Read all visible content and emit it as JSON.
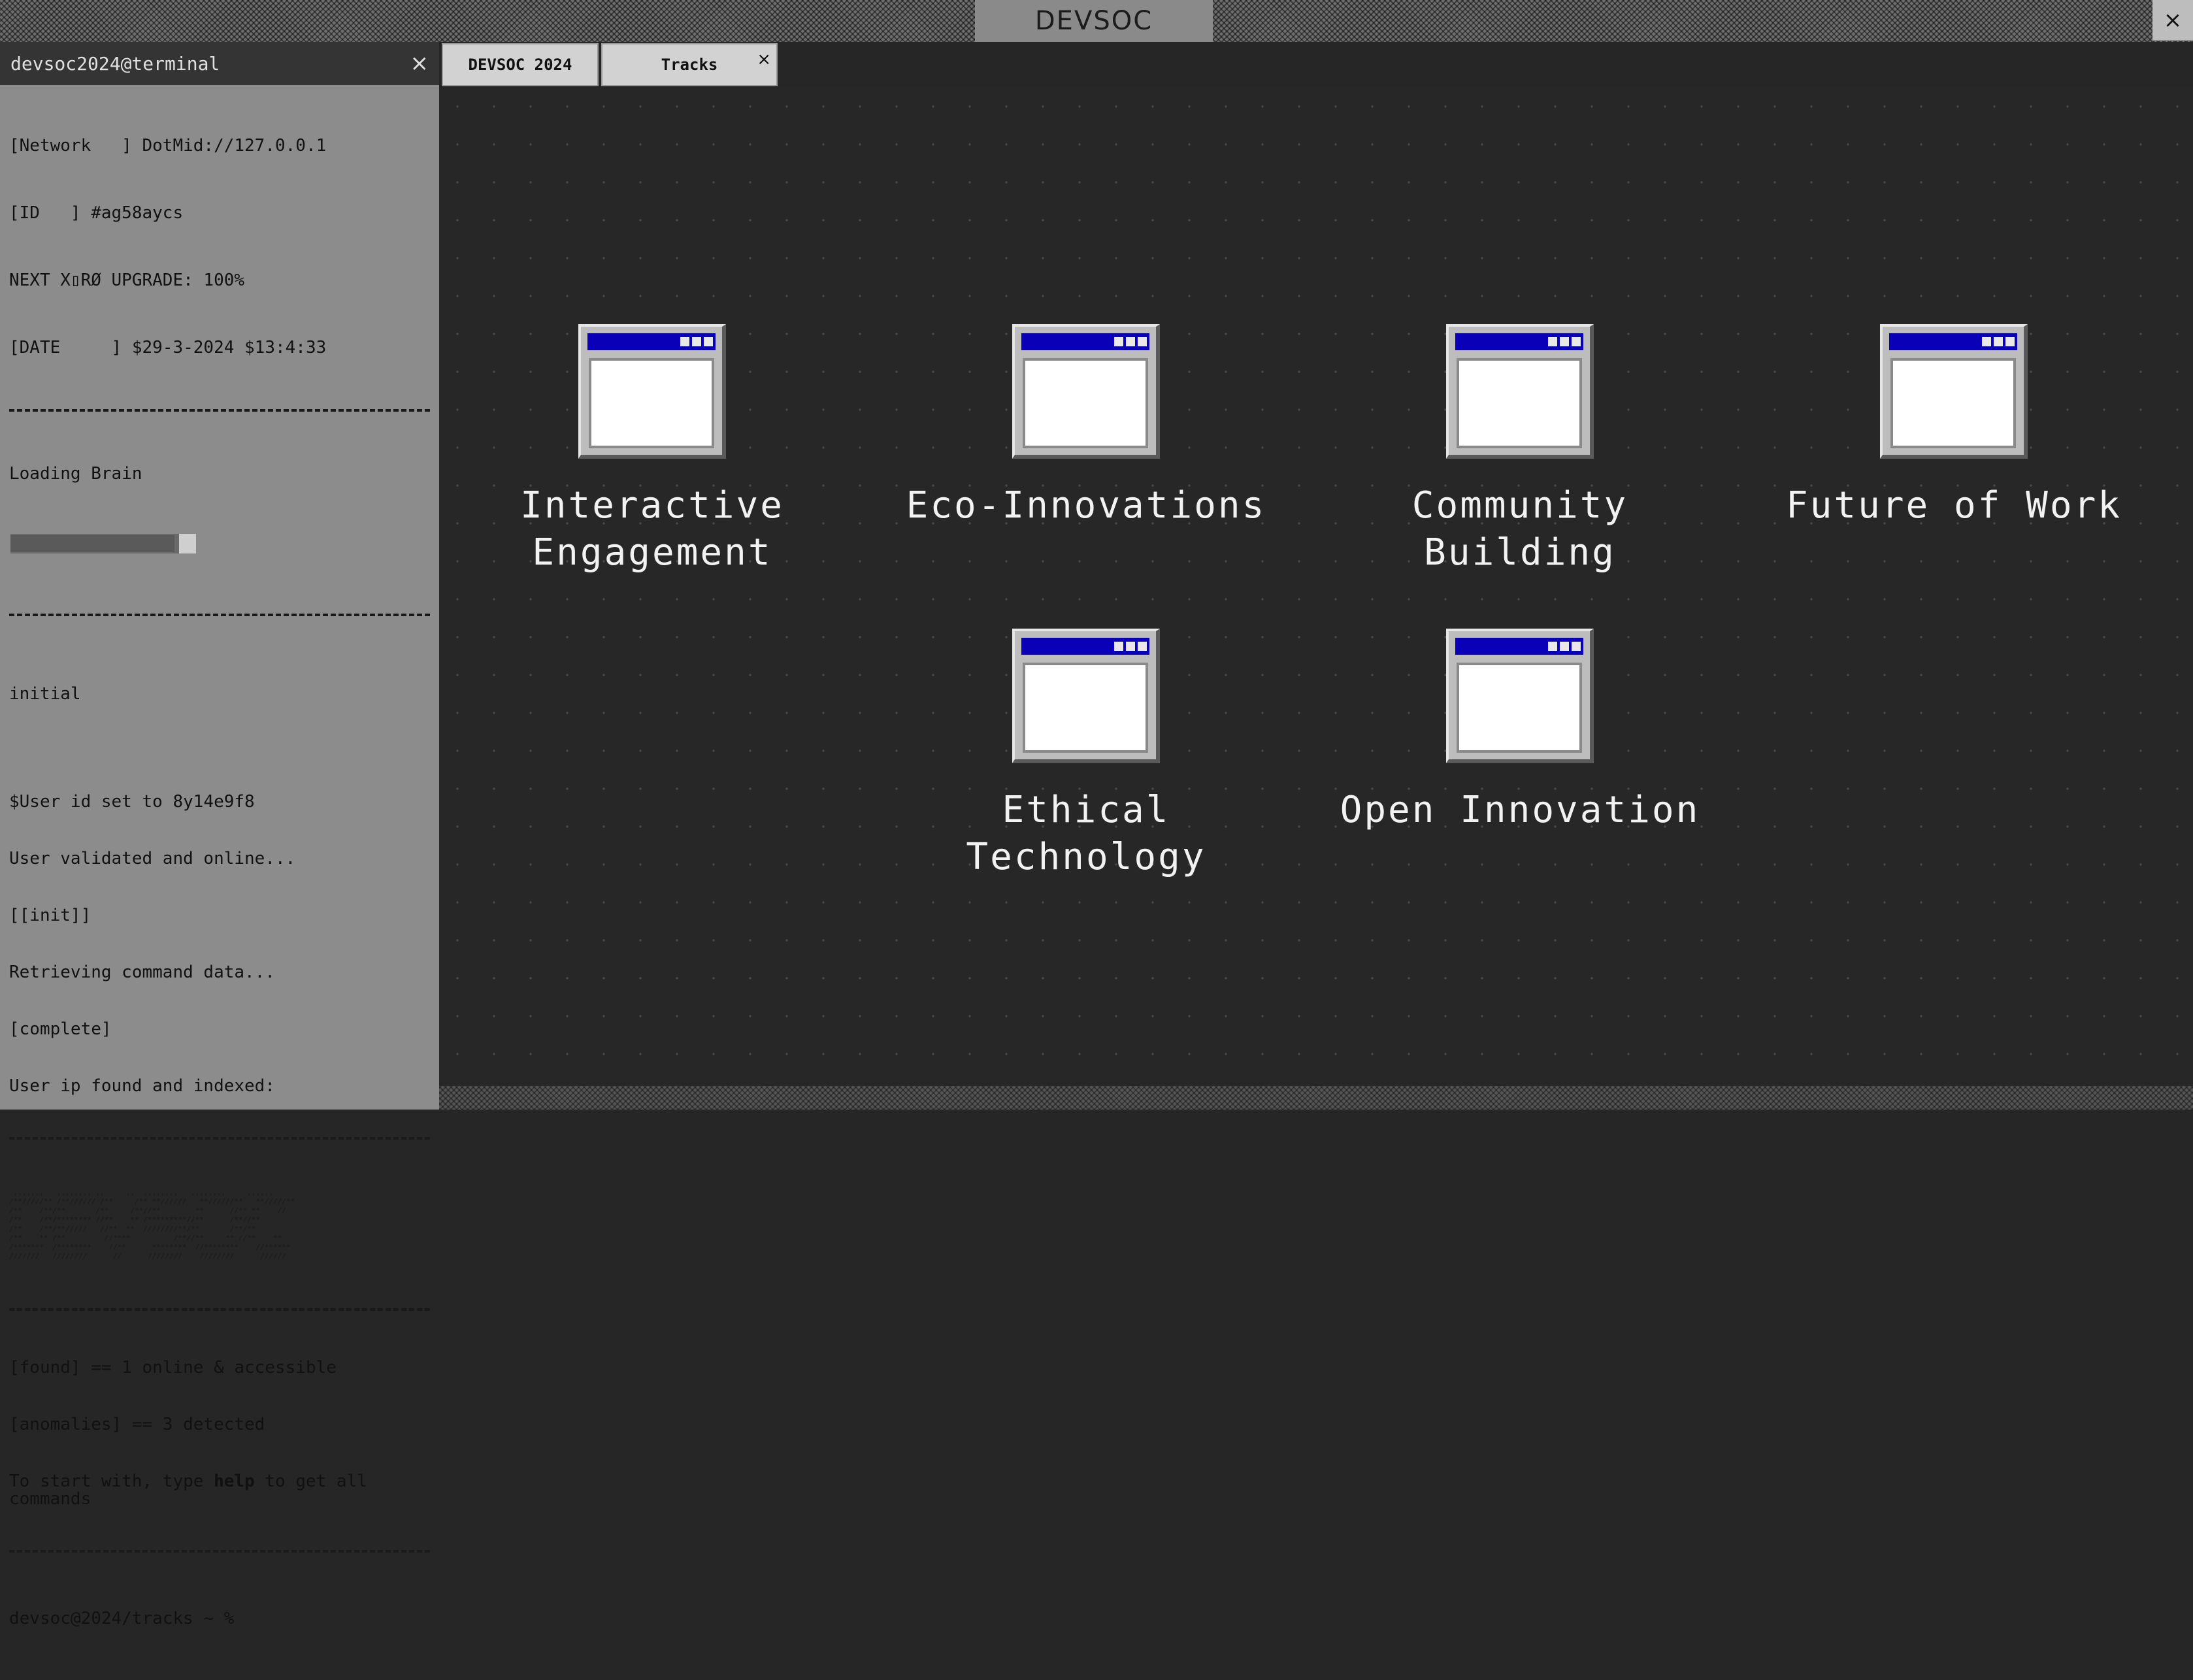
{
  "window": {
    "title": "DEVSOC",
    "close_glyph": "×"
  },
  "terminal": {
    "title": "devsoc2024@terminal",
    "close_glyph": "×",
    "info_lines": [
      "[Network   ] DotMid://127.0.0.1",
      "[ID   ] #ag58aycs",
      "NEXT X▯RØ UPGRADE: 100%",
      "[DATE     ] $29-3-2024 $13:4:33"
    ],
    "loading_label": "Loading Brain",
    "loading_progress": 0.93,
    "status_initial": "initial",
    "log_lines": [
      "$User id set to 8y14e9f8",
      "User validated and online...",
      "[[init]]",
      "Retrieving command data...",
      "[complete]",
      "User ip found and indexed:"
    ],
    "ascii_art": " ,,,,,,,   ,,,,,,,, ,,     ,,  ,,,,,,,,   ,,,,,,,,     ,,,,,,\n/**/////** /**////// /**     /** **//////   **//////**   **/////**\n/**    /**/**       /**     /**//**        **      //** **    //\n/**    /**/******** //**    ** /*********//**      /**//**\n/**    /**/**/////   //**  **  ////////**/**       /**/**\n/**    ** /**         //****          /**//**     ** //**    **\n/*******  /********    //**      ********  //********    //******\n///////   ////////      //      ////////    ////////      //////",
    "found_lines": [
      "[found] == 1 online & accessible",
      "[anomalies] == 3 detected"
    ],
    "help_prefix": "To start with, type ",
    "help_keyword": "help",
    "help_suffix": " to get all commands",
    "prompt": "devsoc@2024/tracks ~ %"
  },
  "tabs": [
    {
      "label": "DEVSOC 2024"
    },
    {
      "label": "Tracks",
      "close_glyph": "×"
    }
  ],
  "tracks": [
    {
      "line1": "Interactive",
      "line2": "Engagement",
      "icon": "window-icon"
    },
    {
      "line1": "Eco-Innovations",
      "line2": "",
      "icon": "window-icon"
    },
    {
      "line1": "Community",
      "line2": "Building",
      "icon": "window-icon"
    },
    {
      "line1": "Future of Work",
      "line2": "",
      "icon": "window-icon"
    },
    {
      "line1": "Ethical",
      "line2": "Technology",
      "icon": "window-icon"
    },
    {
      "line1": "Open Innovation",
      "line2": "",
      "icon": "window-icon"
    }
  ],
  "colors": {
    "icon_titlebar": "#0a00b8",
    "desktop_bg": "#272727",
    "terminal_bg": "#8c8c8c"
  }
}
